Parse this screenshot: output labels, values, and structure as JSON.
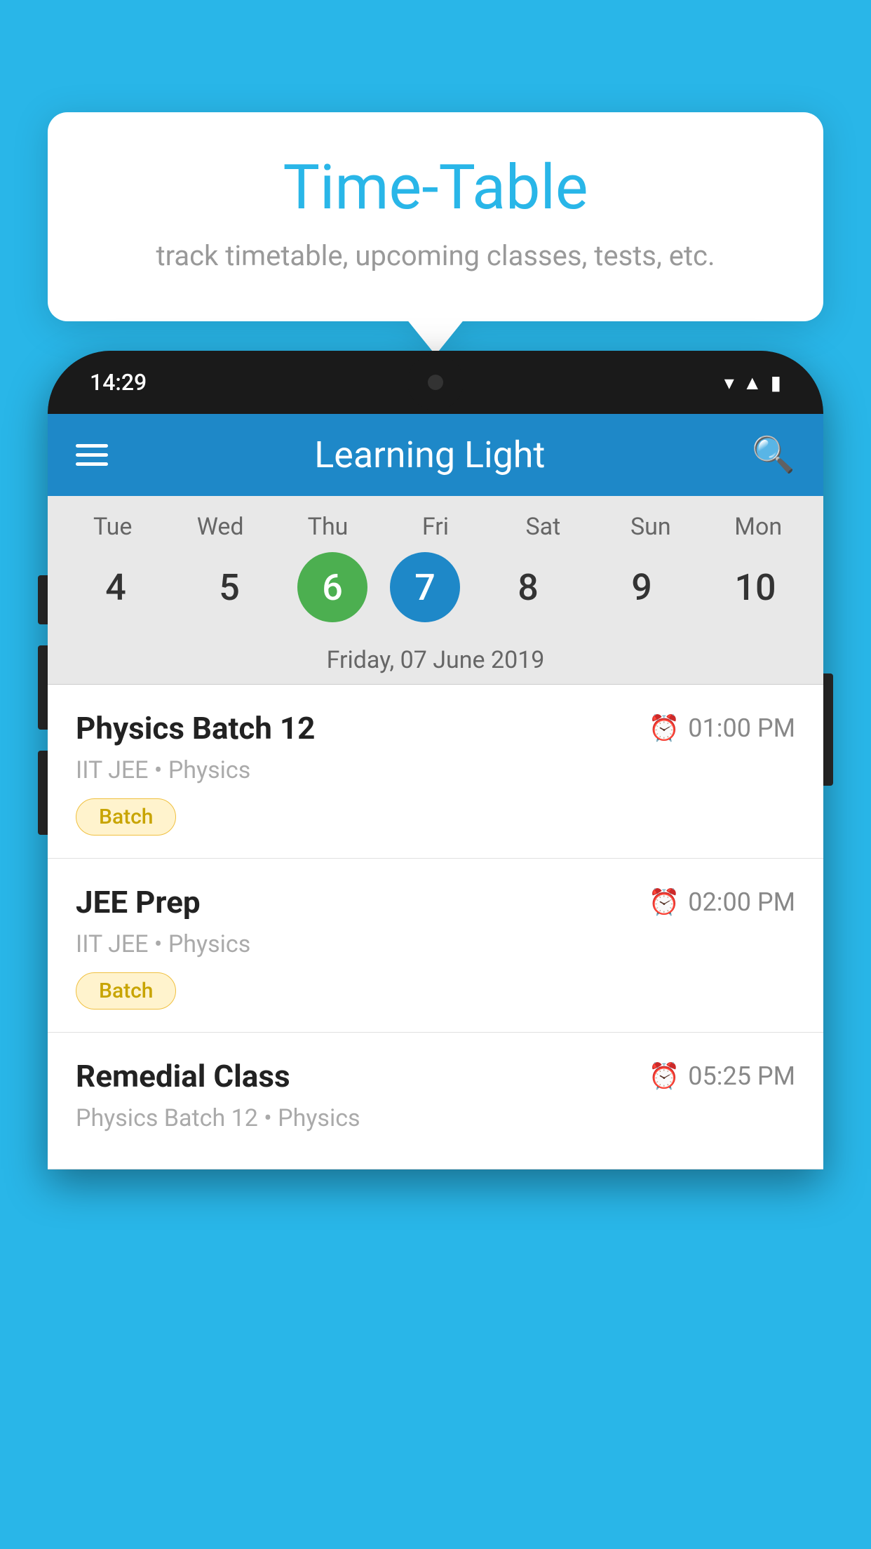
{
  "background_color": "#29b6e8",
  "tooltip": {
    "title": "Time-Table",
    "subtitle": "track timetable, upcoming classes, tests, etc."
  },
  "phone": {
    "time": "14:29",
    "app_title": "Learning Light",
    "calendar": {
      "days": [
        "Tue",
        "Wed",
        "Thu",
        "Fri",
        "Sat",
        "Sun",
        "Mon"
      ],
      "dates": [
        4,
        5,
        6,
        7,
        8,
        9,
        10
      ],
      "today_index": 2,
      "selected_index": 3,
      "selected_label": "Friday, 07 June 2019"
    },
    "schedule": [
      {
        "name": "Physics Batch 12",
        "time": "01:00 PM",
        "detail": "IIT JEE • Physics",
        "tag": "Batch"
      },
      {
        "name": "JEE Prep",
        "time": "02:00 PM",
        "detail": "IIT JEE • Physics",
        "tag": "Batch"
      },
      {
        "name": "Remedial Class",
        "time": "05:25 PM",
        "detail": "Physics Batch 12 • Physics",
        "tag": ""
      }
    ]
  }
}
